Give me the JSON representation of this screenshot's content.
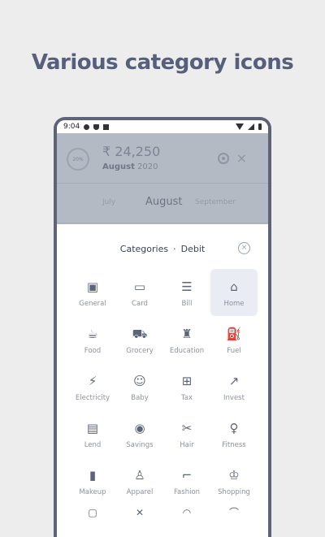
{
  "headline": "Various category icons",
  "status": {
    "time": "9:04",
    "left_icons": [
      "gear-icon",
      "shield-icon",
      "sd-card-icon"
    ],
    "right_icons": [
      "wifi-icon",
      "signal-icon",
      "battery-icon"
    ]
  },
  "balance": {
    "ring_text": "20%",
    "amount": "₹ 24,250",
    "month": "August",
    "year": "2020"
  },
  "months": {
    "prev": "July",
    "current": "August",
    "next": "September"
  },
  "sheet": {
    "title": "Categories",
    "separator": "·",
    "type": "Debit",
    "close_symbol": "×"
  },
  "categories": [
    {
      "label": "General",
      "icon": "banknote-icon",
      "glyph": "▣",
      "selected": false
    },
    {
      "label": "Card",
      "icon": "credit-card-icon",
      "glyph": "▭",
      "selected": false
    },
    {
      "label": "Bill",
      "icon": "bill-icon",
      "glyph": "☰",
      "selected": false
    },
    {
      "label": "Home",
      "icon": "home-icon",
      "glyph": "⌂",
      "selected": true
    },
    {
      "label": "Food",
      "icon": "food-icon",
      "glyph": "☕",
      "selected": false
    },
    {
      "label": "Grocery",
      "icon": "cart-icon",
      "glyph": "⛟",
      "selected": false
    },
    {
      "label": "Education",
      "icon": "graduation-cap-icon",
      "glyph": "♜",
      "selected": false
    },
    {
      "label": "Fuel",
      "icon": "fuel-pump-icon",
      "glyph": "⛽",
      "selected": false
    },
    {
      "label": "Electricity",
      "icon": "lightning-icon",
      "glyph": "⚡",
      "selected": false
    },
    {
      "label": "Baby",
      "icon": "baby-face-icon",
      "glyph": "☺",
      "selected": false
    },
    {
      "label": "Tax",
      "icon": "tax-icon",
      "glyph": "⊞",
      "selected": false
    },
    {
      "label": "Invest",
      "icon": "invest-chart-icon",
      "glyph": "↗",
      "selected": false
    },
    {
      "label": "Lend",
      "icon": "lend-icon",
      "glyph": "▤",
      "selected": false
    },
    {
      "label": "Savings",
      "icon": "piggy-bank-icon",
      "glyph": "◉",
      "selected": false
    },
    {
      "label": "Hair",
      "icon": "hair-dryer-icon",
      "glyph": "✂",
      "selected": false
    },
    {
      "label": "Fitness",
      "icon": "dumbbell-icon",
      "glyph": "♀",
      "selected": false
    },
    {
      "label": "Makeup",
      "icon": "lipstick-icon",
      "glyph": "▮",
      "selected": false
    },
    {
      "label": "Apparel",
      "icon": "tshirt-icon",
      "glyph": "♙",
      "selected": false
    },
    {
      "label": "Fashion",
      "icon": "high-heel-icon",
      "glyph": "⌐",
      "selected": false
    },
    {
      "label": "Shopping",
      "icon": "shopping-bag-icon",
      "glyph": "♔",
      "selected": false
    }
  ],
  "partial_row_icons": [
    "box-icon",
    "tools-icon",
    "car-icon",
    "gift-icon"
  ]
}
